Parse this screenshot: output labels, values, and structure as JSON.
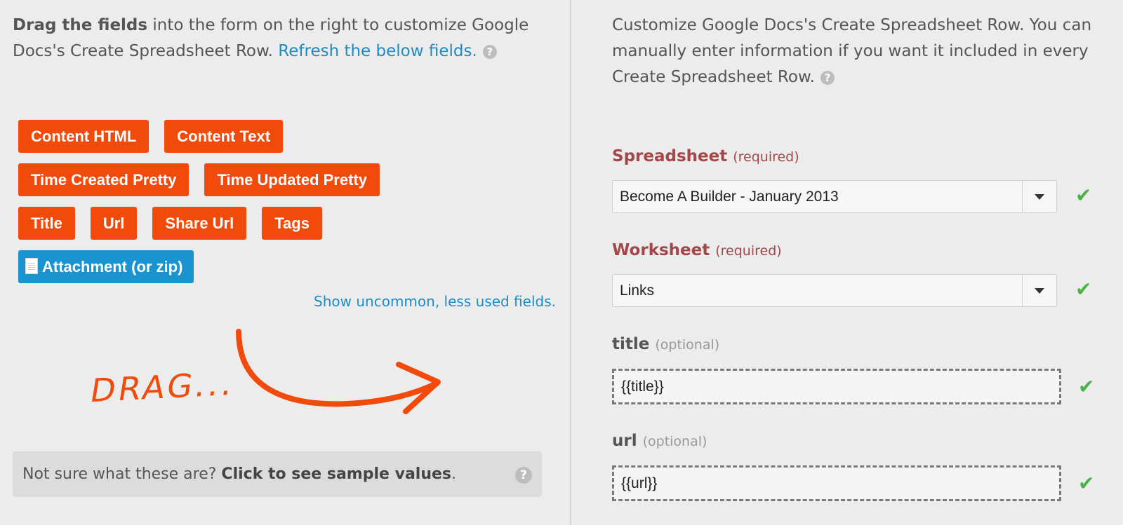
{
  "left": {
    "intro_bold": "Drag the fields",
    "intro_text": " into the form on the right to customize Google Docs's Create Spreadsheet Row. ",
    "intro_link": "Refresh the below fields.",
    "help_glyph": "?",
    "pill_rows": [
      [
        "Content HTML",
        "Content Text"
      ],
      [
        "Time Created Pretty",
        "Time Updated Pretty"
      ],
      [
        "Title",
        "Url",
        "Share Url",
        "Tags"
      ]
    ],
    "attachment_pill": "Attachment (or zip)",
    "uncommon_link": "Show uncommon, less used fields.",
    "drag_text": "DRAG...",
    "sample_text": "Not sure what these are? ",
    "sample_link": "Click to see sample values",
    "sample_end": "."
  },
  "right": {
    "intro": "Customize Google Docs's Create Spreadsheet Row. You can manually enter information if you want it included in every Create Spreadsheet Row.",
    "fields": [
      {
        "label": "Spreadsheet",
        "note": "(required)",
        "value": "Become A Builder - January 2013"
      },
      {
        "label": "Worksheet",
        "note": "(required)",
        "value": "Links"
      },
      {
        "label": "title",
        "note": "(optional)",
        "value": "{{title}}"
      },
      {
        "label": "url",
        "note": "(optional)",
        "value": "{{url}}"
      }
    ],
    "check_glyph": "✔"
  },
  "colors": {
    "pill_orange": "#f24a0a",
    "pill_blue": "#1a93d1",
    "link_blue": "#1e8bc3",
    "required_red": "#a3474a",
    "check_green": "#49b347"
  }
}
